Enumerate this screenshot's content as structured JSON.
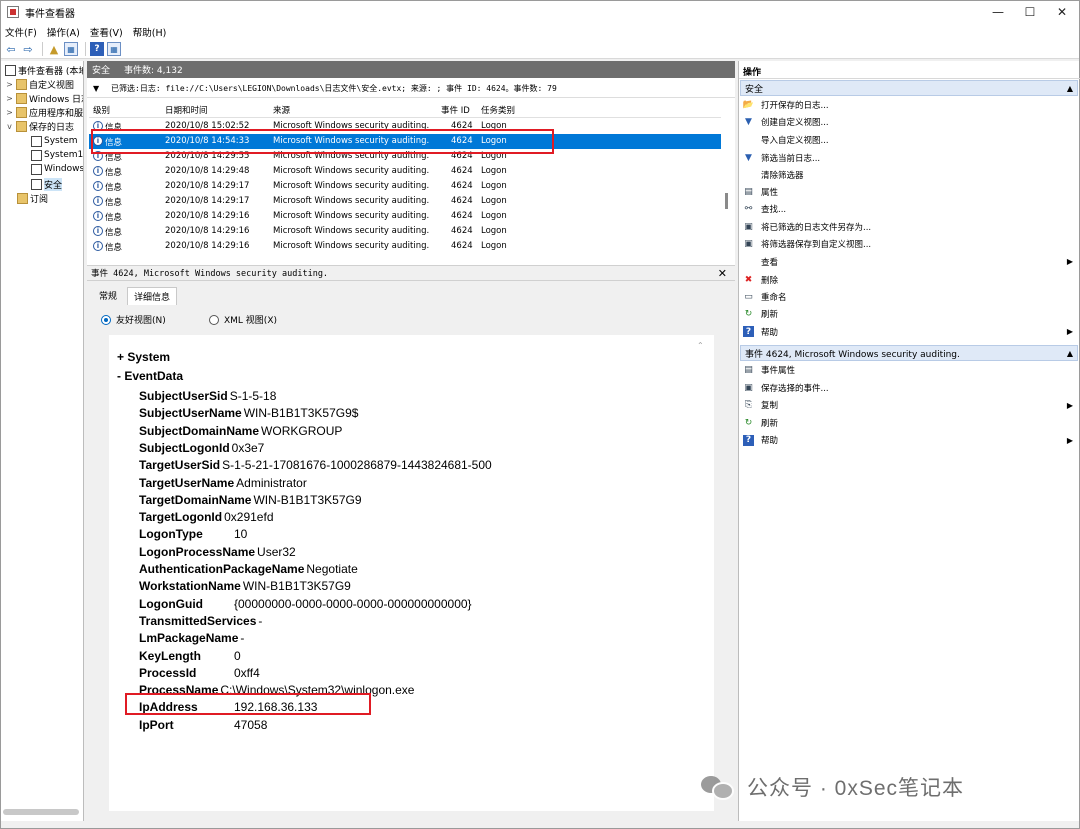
{
  "window": {
    "title": "事件查看器"
  },
  "menu": [
    "文件(F)",
    "操作(A)",
    "查看(V)",
    "帮助(H)"
  ],
  "tree": [
    {
      "label": "事件查看器 (本地)",
      "expander": ""
    },
    {
      "label": "自定义视图",
      "expander": ">"
    },
    {
      "label": "Windows 日志",
      "expander": ">"
    },
    {
      "label": "应用程序和服务日志",
      "expander": ">"
    },
    {
      "label": "保存的日志",
      "expander": "v"
    },
    {
      "label": "System",
      "expander": ""
    },
    {
      "label": "System1",
      "expander": ""
    },
    {
      "label": "Windows",
      "expander": ""
    },
    {
      "label": "安全",
      "expander": ""
    },
    {
      "label": "订阅",
      "expander": ""
    }
  ],
  "log_header": {
    "name": "安全",
    "count": "事件数: 4,132"
  },
  "filter_text": "已筛选:日志: file://C:\\Users\\LEGION\\Downloads\\日志文件\\安全.evtx; 来源: ; 事件 ID: 4624。事件数: 79",
  "columns": [
    "级别",
    "日期和时间",
    "来源",
    "事件 ID",
    "任务类别"
  ],
  "events": [
    {
      "level": "信息",
      "datetime": "2020/10/8 15:02:52",
      "source": "Microsoft Windows security auditing.",
      "id": "4624",
      "task": "Logon"
    },
    {
      "level": "信息",
      "datetime": "2020/10/8 14:54:33",
      "source": "Microsoft Windows security auditing.",
      "id": "4624",
      "task": "Logon"
    },
    {
      "level": "信息",
      "datetime": "2020/10/8 14:29:55",
      "source": "Microsoft Windows security auditing.",
      "id": "4624",
      "task": "Logon"
    },
    {
      "level": "信息",
      "datetime": "2020/10/8 14:29:48",
      "source": "Microsoft Windows security auditing.",
      "id": "4624",
      "task": "Logon"
    },
    {
      "level": "信息",
      "datetime": "2020/10/8 14:29:17",
      "source": "Microsoft Windows security auditing.",
      "id": "4624",
      "task": "Logon"
    },
    {
      "level": "信息",
      "datetime": "2020/10/8 14:29:17",
      "source": "Microsoft Windows security auditing.",
      "id": "4624",
      "task": "Logon"
    },
    {
      "level": "信息",
      "datetime": "2020/10/8 14:29:16",
      "source": "Microsoft Windows security auditing.",
      "id": "4624",
      "task": "Logon"
    },
    {
      "level": "信息",
      "datetime": "2020/10/8 14:29:16",
      "source": "Microsoft Windows security auditing.",
      "id": "4624",
      "task": "Logon"
    },
    {
      "level": "信息",
      "datetime": "2020/10/8 14:29:16",
      "source": "Microsoft Windows security auditing.",
      "id": "4624",
      "task": "Logon"
    }
  ],
  "detail": {
    "header": "事件 4624, Microsoft Windows security auditing.",
    "tabs": [
      "常规",
      "详细信息"
    ],
    "views": [
      "友好视图(N)",
      "XML 视图(X)"
    ],
    "system_label": "+ System",
    "eventdata_label": "-  EventData",
    "fields": [
      {
        "k": "SubjectUserSid",
        "v": "S-1-5-18"
      },
      {
        "k": "SubjectUserName",
        "v": "WIN-B1B1T3K57G9$"
      },
      {
        "k": "SubjectDomainName",
        "v": "WORKGROUP"
      },
      {
        "k": "SubjectLogonId",
        "v": "0x3e7"
      },
      {
        "k": "TargetUserSid",
        "v": "S-1-5-21-17081676-1000286879-1443824681-500"
      },
      {
        "k": "TargetUserName",
        "v": "Administrator"
      },
      {
        "k": "TargetDomainName",
        "v": "WIN-B1B1T3K57G9"
      },
      {
        "k": "TargetLogonId",
        "v": "0x291efd"
      },
      {
        "k": "LogonType",
        "v": "10"
      },
      {
        "k": "LogonProcessName",
        "v": "User32"
      },
      {
        "k": "AuthenticationPackageName",
        "v": "Negotiate"
      },
      {
        "k": "WorkstationName",
        "v": "WIN-B1B1T3K57G9"
      },
      {
        "k": "LogonGuid",
        "v": "{00000000-0000-0000-0000-000000000000}"
      },
      {
        "k": "TransmittedServices",
        "v": "-"
      },
      {
        "k": "LmPackageName",
        "v": "-"
      },
      {
        "k": "KeyLength",
        "v": "0"
      },
      {
        "k": "ProcessId",
        "v": "0xff4"
      },
      {
        "k": "ProcessName",
        "v": "C:\\Windows\\System32\\winlogon.exe"
      },
      {
        "k": "IpAddress",
        "v": "192.168.36.133"
      },
      {
        "k": "IpPort",
        "v": "47058"
      }
    ]
  },
  "actions": {
    "title": "操作",
    "group1": "安全",
    "group1_items": [
      {
        "label": "打开保存的日志...",
        "icon": "open-icon",
        "more": ""
      },
      {
        "label": "创建自定义视图...",
        "icon": "filter-icon",
        "more": ""
      },
      {
        "label": "导入自定义视图...",
        "icon": "",
        "more": ""
      },
      {
        "label": "筛选当前日志...",
        "icon": "filter-icon",
        "more": ""
      },
      {
        "label": "清除筛选器",
        "icon": "",
        "more": ""
      },
      {
        "label": "属性",
        "icon": "properties-icon",
        "more": ""
      },
      {
        "label": "查找...",
        "icon": "binoculars-icon",
        "more": ""
      },
      {
        "label": "将已筛选的日志文件另存为...",
        "icon": "save-icon",
        "more": ""
      },
      {
        "label": "将筛选器保存到自定义视图...",
        "icon": "save-icon",
        "more": ""
      },
      {
        "label": "查看",
        "icon": "",
        "more": "▶"
      },
      {
        "label": "删除",
        "icon": "delete-icon",
        "more": ""
      },
      {
        "label": "重命名",
        "icon": "rename-icon",
        "more": ""
      },
      {
        "label": "刷新",
        "icon": "refresh-icon",
        "more": ""
      },
      {
        "label": "帮助",
        "icon": "help-icon",
        "more": "▶"
      }
    ],
    "group2": "事件 4624, Microsoft Windows security auditing.",
    "group2_items": [
      {
        "label": "事件属性",
        "icon": "properties-icon",
        "more": ""
      },
      {
        "label": "保存选择的事件...",
        "icon": "save-icon",
        "more": ""
      },
      {
        "label": "复制",
        "icon": "copy-icon",
        "more": "▶"
      },
      {
        "label": "刷新",
        "icon": "refresh-icon",
        "more": ""
      },
      {
        "label": "帮助",
        "icon": "help-icon",
        "more": "▶"
      }
    ]
  },
  "watermark": "公众号 · 0xSec笔记本",
  "colors": {
    "selection": "#0078d7",
    "highlight_box": "#e01b24",
    "header_gray": "#6e6e6e"
  }
}
